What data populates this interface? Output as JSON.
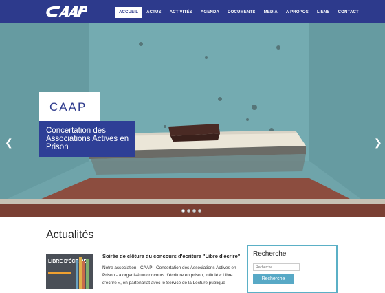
{
  "header": {
    "logo_text": "CAAP",
    "nav": [
      {
        "label": "ACCUEIL",
        "active": true
      },
      {
        "label": "ACTUS",
        "active": false
      },
      {
        "label": "ACTIVITÉS",
        "active": false
      },
      {
        "label": "AGENDA",
        "active": false
      },
      {
        "label": "DOCUMENTS",
        "active": false
      },
      {
        "label": "MEDIA",
        "active": false
      },
      {
        "label": "A PROPOS",
        "active": false
      },
      {
        "label": "LIENS",
        "active": false
      },
      {
        "label": "CONTACT",
        "active": false
      }
    ]
  },
  "slider": {
    "caption_title": "CAAP",
    "caption_text": "Concertation des Associations Actives en Prison",
    "prev_icon": "chevron-left-icon",
    "next_icon": "chevron-right-icon",
    "slide_count": 4,
    "active_slide": 1
  },
  "news": {
    "heading": "Actualités",
    "article": {
      "title": "Soirée de clôture du concours d'écriture \"Libre d'écrire\"",
      "excerpt": "Notre association - CAAP - Concertation des Associations Actives en Prison - a organisé un concours d'écriture en prison, intitulé « Libre d'écrire », en partenariat avec le Service de la Lecture publique",
      "thumb_text": "LIBRE D'ÉCRIRE"
    }
  },
  "search": {
    "title": "Recherche",
    "placeholder": "Recherche...",
    "button": "Recherche"
  },
  "colors": {
    "brand": "#2d3a8c",
    "caption_blue": "#2e3f96",
    "accent": "#58a9c6"
  }
}
